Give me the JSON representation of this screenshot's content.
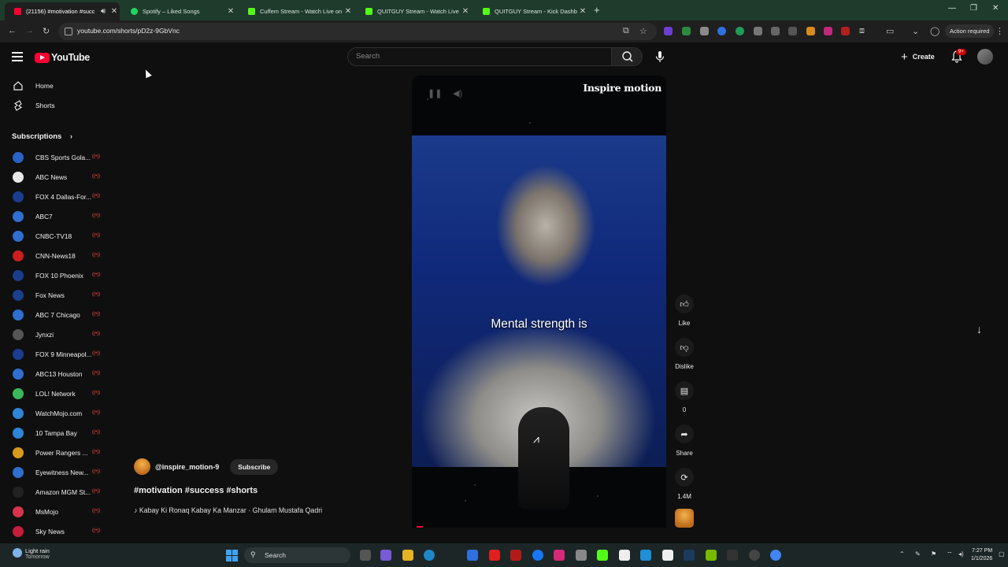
{
  "browser": {
    "tabs": [
      {
        "title": "(21156) #motivation #succ",
        "color": "#ff0033",
        "active": true
      },
      {
        "title": "Spotify – Liked Songs",
        "color": "#1ed760",
        "active": false
      },
      {
        "title": "Cuffem Stream - Watch Live on",
        "color": "#53fc18",
        "active": false
      },
      {
        "title": "QUITGUY Stream - Watch Live",
        "color": "#53fc18",
        "active": false
      },
      {
        "title": "QUITGUY Stream - Kick Dashbo",
        "color": "#53fc18",
        "active": false
      }
    ],
    "url": "youtube.com/shorts/pD2z-9GbVnc",
    "action_required": "Action required"
  },
  "youtube": {
    "logo_text": "YouTube",
    "search_placeholder": "Search",
    "create_label": "Create",
    "notif_badge": "9+"
  },
  "sidebar": {
    "items": [
      {
        "label": "Home",
        "icon": "home-icon"
      },
      {
        "label": "Shorts",
        "icon": "shorts-icon"
      }
    ],
    "subscriptions_title": "Subscriptions",
    "subscriptions": [
      {
        "name": "CBS Sports Gola...",
        "color": "#2b62c7"
      },
      {
        "name": "ABC News",
        "color": "#e8e8e8"
      },
      {
        "name": "FOX 4 Dallas-For...",
        "color": "#1a3d8f"
      },
      {
        "name": "ABC7",
        "color": "#2e6fd0"
      },
      {
        "name": "CNBC-TV18",
        "color": "#2e6fd0"
      },
      {
        "name": "CNN-News18",
        "color": "#cc1e1e"
      },
      {
        "name": "FOX 10 Phoenix",
        "color": "#1a3d8f"
      },
      {
        "name": "Fox News",
        "color": "#1b3f8d"
      },
      {
        "name": "ABC 7 Chicago",
        "color": "#2e6fd0"
      },
      {
        "name": "Jynxzi",
        "color": "#555555"
      },
      {
        "name": "FOX 9 Minneapol...",
        "color": "#1a3d8f"
      },
      {
        "name": "ABC13 Houston",
        "color": "#2e6fd0"
      },
      {
        "name": "LOL! Network",
        "color": "#3cb85c"
      },
      {
        "name": "WatchMojo.com",
        "color": "#2e84d6"
      },
      {
        "name": "10 Tampa Bay",
        "color": "#2e84d6"
      },
      {
        "name": "Power Rangers ...",
        "color": "#d89a1c"
      },
      {
        "name": "Eyewitness New...",
        "color": "#2e6fd0"
      },
      {
        "name": "Amazon MGM St...",
        "color": "#222222"
      },
      {
        "name": "MsMojo",
        "color": "#d8344b"
      },
      {
        "name": "Sky News",
        "color": "#c61d3b"
      }
    ]
  },
  "short": {
    "brand": "Inspire motion",
    "caption": "Mental strength is",
    "channel": "@inspire_motion-9",
    "subscribe": "Subscribe",
    "title": "#motivation #success #shorts",
    "music": "♪ Kabay Ki Ronaq Kabay Ka Manzar · Ghulam Mustafa Qadri",
    "actions": {
      "like": "Like",
      "dislike": "Dislike",
      "comments": "0",
      "share": "Share",
      "remix": "1.4M"
    }
  },
  "taskbar": {
    "weather_line1": "Light rain",
    "weather_line2": "Tomorrow",
    "search": "Search",
    "time": "7:27 PM",
    "date": "1/1/2026"
  }
}
